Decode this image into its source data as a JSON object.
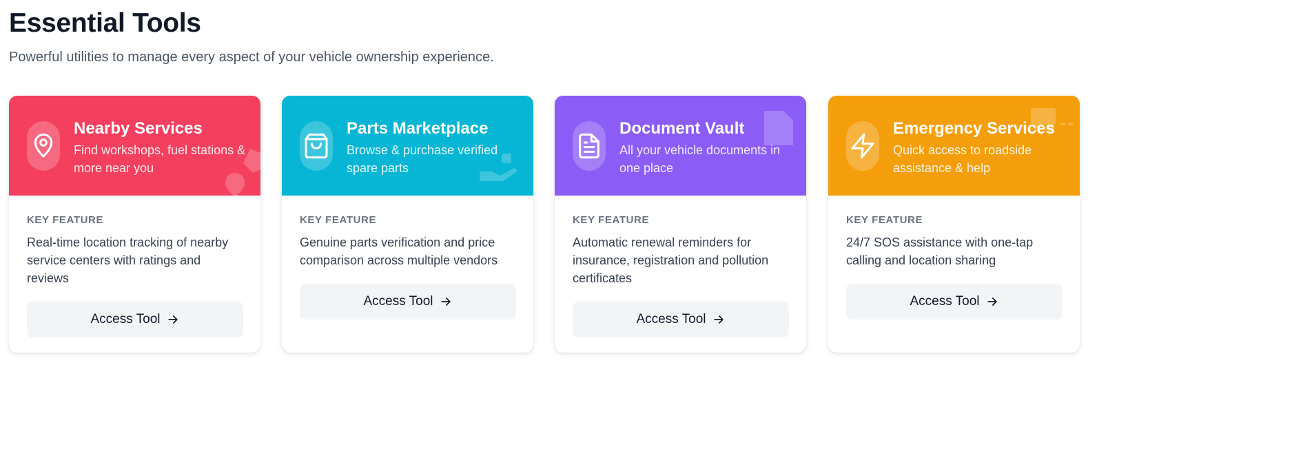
{
  "page": {
    "title": "Essential Tools",
    "subtitle": "Powerful utilities to manage every aspect of your vehicle ownership experience."
  },
  "cards": [
    {
      "title": "Nearby Services",
      "description": "Find workshops, fuel stations & more near you",
      "key_feature_label": "KEY FEATURE",
      "key_feature": "Real-time location tracking of nearby service centers with ratings and reviews",
      "button_label": "Access Tool",
      "icon": "map-pin-icon",
      "color": "#f43f5e"
    },
    {
      "title": "Parts Marketplace",
      "description": "Browse & purchase verified spare parts",
      "key_feature_label": "KEY FEATURE",
      "key_feature": "Genuine parts verification and price comparison across multiple vendors",
      "button_label": "Access Tool",
      "icon": "shopping-bag-icon",
      "color": "#06b6d4"
    },
    {
      "title": "Document Vault",
      "description": "All your vehicle documents in one place",
      "key_feature_label": "KEY FEATURE",
      "key_feature": "Automatic renewal reminders for insurance, registration and pollution certificates",
      "button_label": "Access Tool",
      "icon": "document-icon",
      "color": "#8b5cf6"
    },
    {
      "title": "Emergency Services",
      "description": "Quick access to roadside assistance & help",
      "key_feature_label": "KEY FEATURE",
      "key_feature": "24/7 SOS assistance with one-tap calling and location sharing",
      "button_label": "Access Tool",
      "icon": "lightning-bolt-icon",
      "color": "#f59e0b"
    }
  ]
}
